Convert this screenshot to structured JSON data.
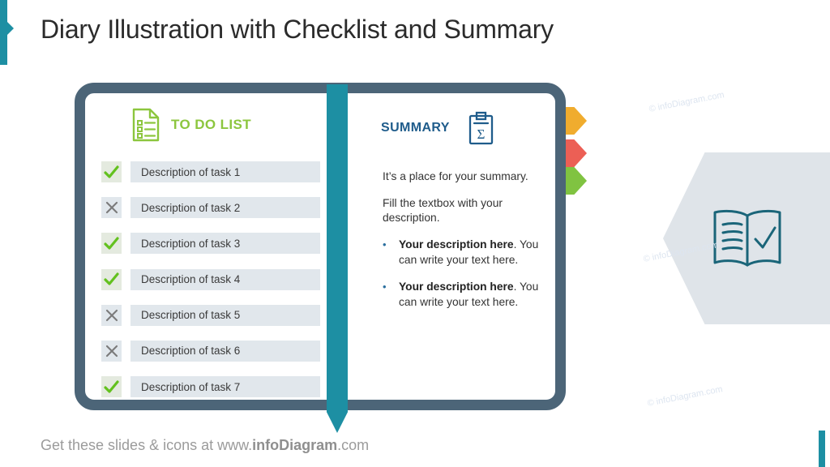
{
  "slide": {
    "title": "Diary Illustration with Checklist and Summary",
    "footer_prefix": "Get these slides & icons at www.",
    "footer_brand": "infoDiagram",
    "footer_suffix": ".com",
    "watermark": "© infoDiagram.com"
  },
  "colors": {
    "accent_teal": "#1D8FA3",
    "book_border": "#4C6578",
    "todo_green": "#8CC63E",
    "summary_blue": "#1F5C8B",
    "tab_orange": "#F0AC2E",
    "tab_red": "#EC5F55",
    "tab_green": "#80C341",
    "task_row_bg": "#E1E7EC",
    "hex_grey": "#DFE4E9"
  },
  "left_page": {
    "heading": "TO DO LIST",
    "icon": "checklist-document-icon",
    "tasks": [
      {
        "label": "Description of task 1",
        "state": "done"
      },
      {
        "label": "Description of task 2",
        "state": "undone"
      },
      {
        "label": "Description of task 3",
        "state": "done"
      },
      {
        "label": "Description of task 4",
        "state": "done"
      },
      {
        "label": "Description of task 5",
        "state": "undone"
      },
      {
        "label": "Description of task 6",
        "state": "undone"
      },
      {
        "label": "Description of task 7",
        "state": "done"
      }
    ]
  },
  "right_page": {
    "heading": "SUMMARY",
    "icon": "clipboard-sigma-icon",
    "paragraphs": [
      "It’s a place for your summary.",
      "Fill the textbox with your description."
    ],
    "bullets": [
      {
        "bold": "Your description here",
        "rest": ". You can write your text here."
      },
      {
        "bold": "Your description here",
        "rest": ". You can write your text here."
      }
    ]
  },
  "tabs": [
    {
      "name": "tab-orange",
      "color": "#F0AC2E"
    },
    {
      "name": "tab-red",
      "color": "#EC5F55"
    },
    {
      "name": "tab-green",
      "color": "#80C341"
    }
  ],
  "decoration": {
    "hexagon_icon": "open-book-check-icon"
  }
}
